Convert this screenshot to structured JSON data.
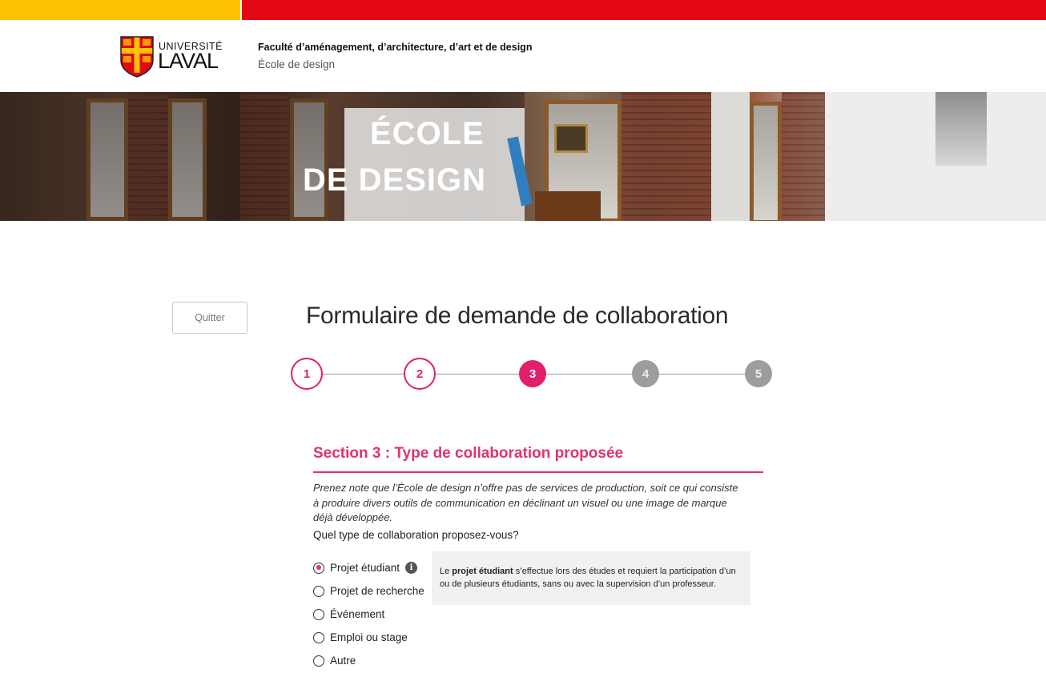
{
  "brand": {
    "university_line1": "UNIVERSITÉ",
    "university_line2": "LAVAL",
    "colors": {
      "gold": "#ffc103",
      "red": "#e30613",
      "accent": "#e0336f"
    }
  },
  "header": {
    "faculty": "Faculté d’aménagement, d’architecture, d’art et de design",
    "school": "École de design"
  },
  "banner": {
    "title_line1": "ÉCOLE",
    "title_line2": "DE DESIGN"
  },
  "form": {
    "quit_label": "Quitter",
    "title": "Formulaire de demande de collaboration",
    "steps": [
      {
        "label": "1",
        "state": "done"
      },
      {
        "label": "2",
        "state": "done"
      },
      {
        "label": "3",
        "state": "current"
      },
      {
        "label": "4",
        "state": "todo"
      },
      {
        "label": "5",
        "state": "todo"
      }
    ],
    "section_title": "Section 3 : Type de collaboration proposée",
    "note": "Prenez note que l’École de design n’offre pas de services de production, soit ce qui consiste à produire divers outils de communication en déclinant un visuel ou une image de marque déjà développée.",
    "question": "Quel type de collaboration proposez-vous?",
    "options": [
      {
        "label": "Projet étudiant",
        "selected": true,
        "icon": "info-icon"
      },
      {
        "label": "Projet de recherche",
        "selected": false
      },
      {
        "label": "Événement",
        "selected": false
      },
      {
        "label": "Emploi ou stage",
        "selected": false
      },
      {
        "label": "Autre",
        "selected": false
      }
    ],
    "info": {
      "prefix": "Le ",
      "bold": "projet étudiant",
      "suffix": " s’effectue lors des études et requiert la participation d’un ou de plusieurs étudiants, sans ou avec la supervision d’un professeur."
    }
  }
}
